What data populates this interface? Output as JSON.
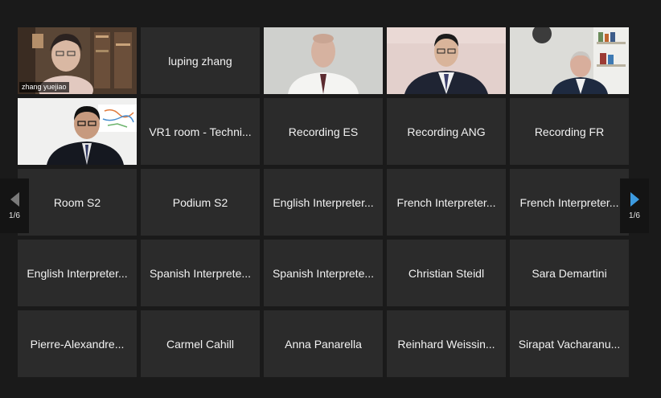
{
  "pager": {
    "left_label": "1/6",
    "right_label": "1/6"
  },
  "participants": [
    {
      "name": "zhang yuejiao",
      "video": "elderly-woman-bookshelf",
      "active": true
    },
    {
      "name": "luping zhang"
    },
    {
      "name": "",
      "video": "man-white-shirt"
    },
    {
      "name": "",
      "video": "man-suit-glasses"
    },
    {
      "name": "",
      "video": "older-man-bookshelf"
    },
    {
      "name": "",
      "video": "man-dark-suit-whiteboard"
    },
    {
      "name": "VR1 room - Techni..."
    },
    {
      "name": "Recording ES"
    },
    {
      "name": "Recording ANG"
    },
    {
      "name": "Recording FR"
    },
    {
      "name": "Room S2"
    },
    {
      "name": "Podium S2"
    },
    {
      "name": "English Interpreter..."
    },
    {
      "name": "French Interpreter..."
    },
    {
      "name": "French Interpreter..."
    },
    {
      "name": "English Interpreter..."
    },
    {
      "name": "Spanish Interprete..."
    },
    {
      "name": "Spanish Interprete..."
    },
    {
      "name": "Christian Steidl"
    },
    {
      "name": "Sara Demartini"
    },
    {
      "name": "Pierre-Alexandre..."
    },
    {
      "name": "Carmel Cahill"
    },
    {
      "name": "Anna Panarella"
    },
    {
      "name": "Reinhard Weissin..."
    },
    {
      "name": "Sirapat Vacharanu..."
    }
  ]
}
